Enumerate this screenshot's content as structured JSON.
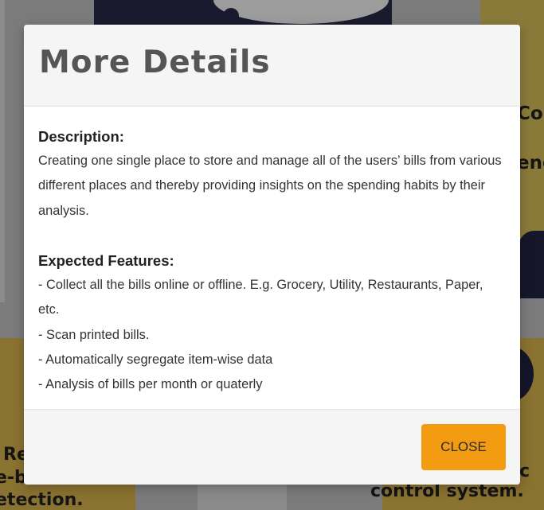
{
  "modal": {
    "title": "More Details",
    "description_heading": "Description:",
    "description_text": "Creating one single place to store and manage all of the users’ bills from various different places and thereby providing insights on the spending habits by their analysis.",
    "features_heading": "Expected Features:",
    "features": [
      "- Collect all the bills online or offline. E.g. Grocery, Utility, Restaurants, Paper, etc.",
      "- Scan printed bills.",
      "- Automatically segregate item-wise data",
      "- Analysis of bills per month or quaterly"
    ],
    "close_label": "CLOSE"
  },
  "background": {
    "text_col": "Col",
    "text_eng": "eng",
    "text_re": "Re",
    "text_eb": "e-b",
    "text_det": "etection.",
    "text_c": "c",
    "text_ctrl": "control system."
  },
  "colors": {
    "accent": "#f39c12",
    "overlay": "#7b7b7b",
    "modal_header_bg": "#f5f5f5",
    "title_color": "#555555"
  }
}
